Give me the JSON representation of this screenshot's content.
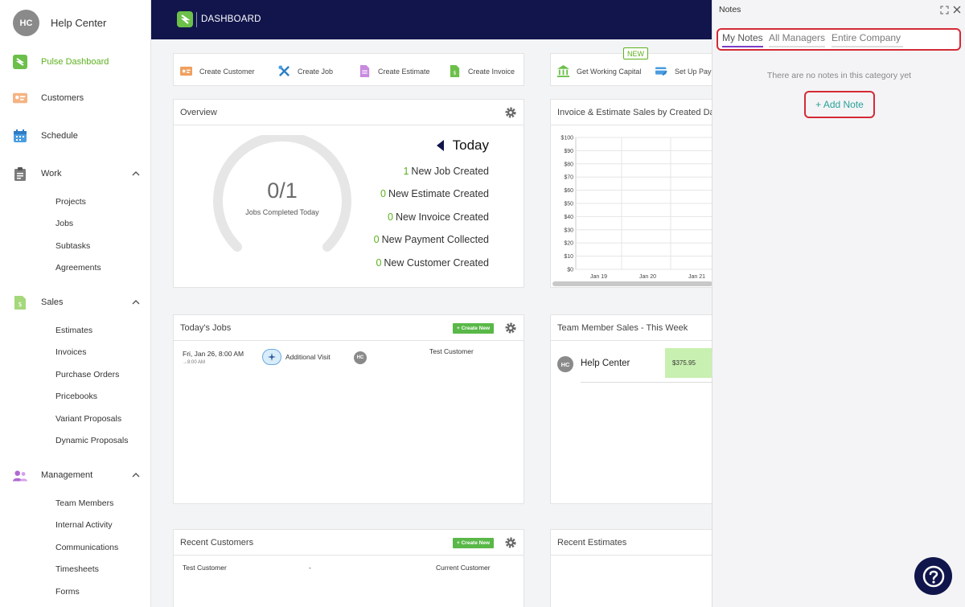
{
  "sidebar": {
    "avatar_initials": "HC",
    "brand_label": "Help Center",
    "items": [
      {
        "label": "Pulse Dashboard"
      },
      {
        "label": "Customers"
      },
      {
        "label": "Schedule"
      },
      {
        "label": "Work",
        "children": [
          "Projects",
          "Jobs",
          "Subtasks",
          "Agreements"
        ]
      },
      {
        "label": "Sales",
        "children": [
          "Estimates",
          "Invoices",
          "Purchase Orders",
          "Pricebooks",
          "Variant Proposals",
          "Dynamic Proposals"
        ]
      },
      {
        "label": "Management",
        "children": [
          "Team Members",
          "Internal Activity",
          "Communications",
          "Timesheets",
          "Forms"
        ]
      }
    ]
  },
  "header": {
    "title": "DASHBOARD"
  },
  "quick_actions": [
    "Create Customer",
    "Create Job",
    "Create Estimate",
    "Create Invoice"
  ],
  "quick_actions_2": {
    "new_badge": "NEW",
    "items": [
      "Get Working Capital",
      "Set Up Pay"
    ]
  },
  "overview": {
    "title": "Overview",
    "gauge_value": "0/1",
    "gauge_label": "Jobs Completed Today",
    "period_label": "Today",
    "stats": [
      {
        "count": "1",
        "label": "New Job Created"
      },
      {
        "count": "0",
        "label": "New Estimate Created"
      },
      {
        "count": "0",
        "label": "New Invoice Created"
      },
      {
        "count": "0",
        "label": "New Payment Collected"
      },
      {
        "count": "0",
        "label": "New Customer Created"
      }
    ]
  },
  "sales_chart": {
    "title": "Invoice & Estimate Sales by Created Da"
  },
  "chart_data": {
    "type": "bar",
    "title": "Invoice & Estimate Sales by Created Da",
    "categories": [
      "Jan 19",
      "Jan 20",
      "Jan 21"
    ],
    "values": [
      0,
      0,
      0
    ],
    "y_ticks": [
      "$100",
      "$90",
      "$80",
      "$70",
      "$60",
      "$50",
      "$40",
      "$30",
      "$20",
      "$10",
      "$0"
    ],
    "ylim": [
      0,
      100
    ],
    "grid": true
  },
  "todays_jobs": {
    "title": "Today's Jobs",
    "create_label": "+ Create New",
    "rows": [
      {
        "datetime": "Fri, Jan 26, 8:00 AM",
        "end_time": "→8:00 AM",
        "type": "Additional Visit",
        "tech_initials": "HC",
        "customer": "Test Customer"
      }
    ]
  },
  "team_sales": {
    "title": "Team Member Sales - This Week",
    "rows": [
      {
        "initials": "HC",
        "name": "Help Center",
        "amount": "$375.95"
      }
    ]
  },
  "recent_customers": {
    "title": "Recent Customers",
    "create_label": "+ Create New",
    "rows": [
      {
        "name": "Test Customer",
        "col2": "-",
        "status": "Current Customer"
      }
    ]
  },
  "recent_estimates": {
    "title": "Recent Estimates"
  },
  "notes": {
    "title": "Notes",
    "tabs": [
      "My Notes",
      "All Managers",
      "Entire Company"
    ],
    "empty_text": "There are no notes in this category yet",
    "add_label": "+ Add Note"
  },
  "colors": {
    "accent_green": "#5cb11e",
    "header_navy": "#11154c",
    "highlight_red": "#d42a35",
    "teal": "#2aa198"
  }
}
